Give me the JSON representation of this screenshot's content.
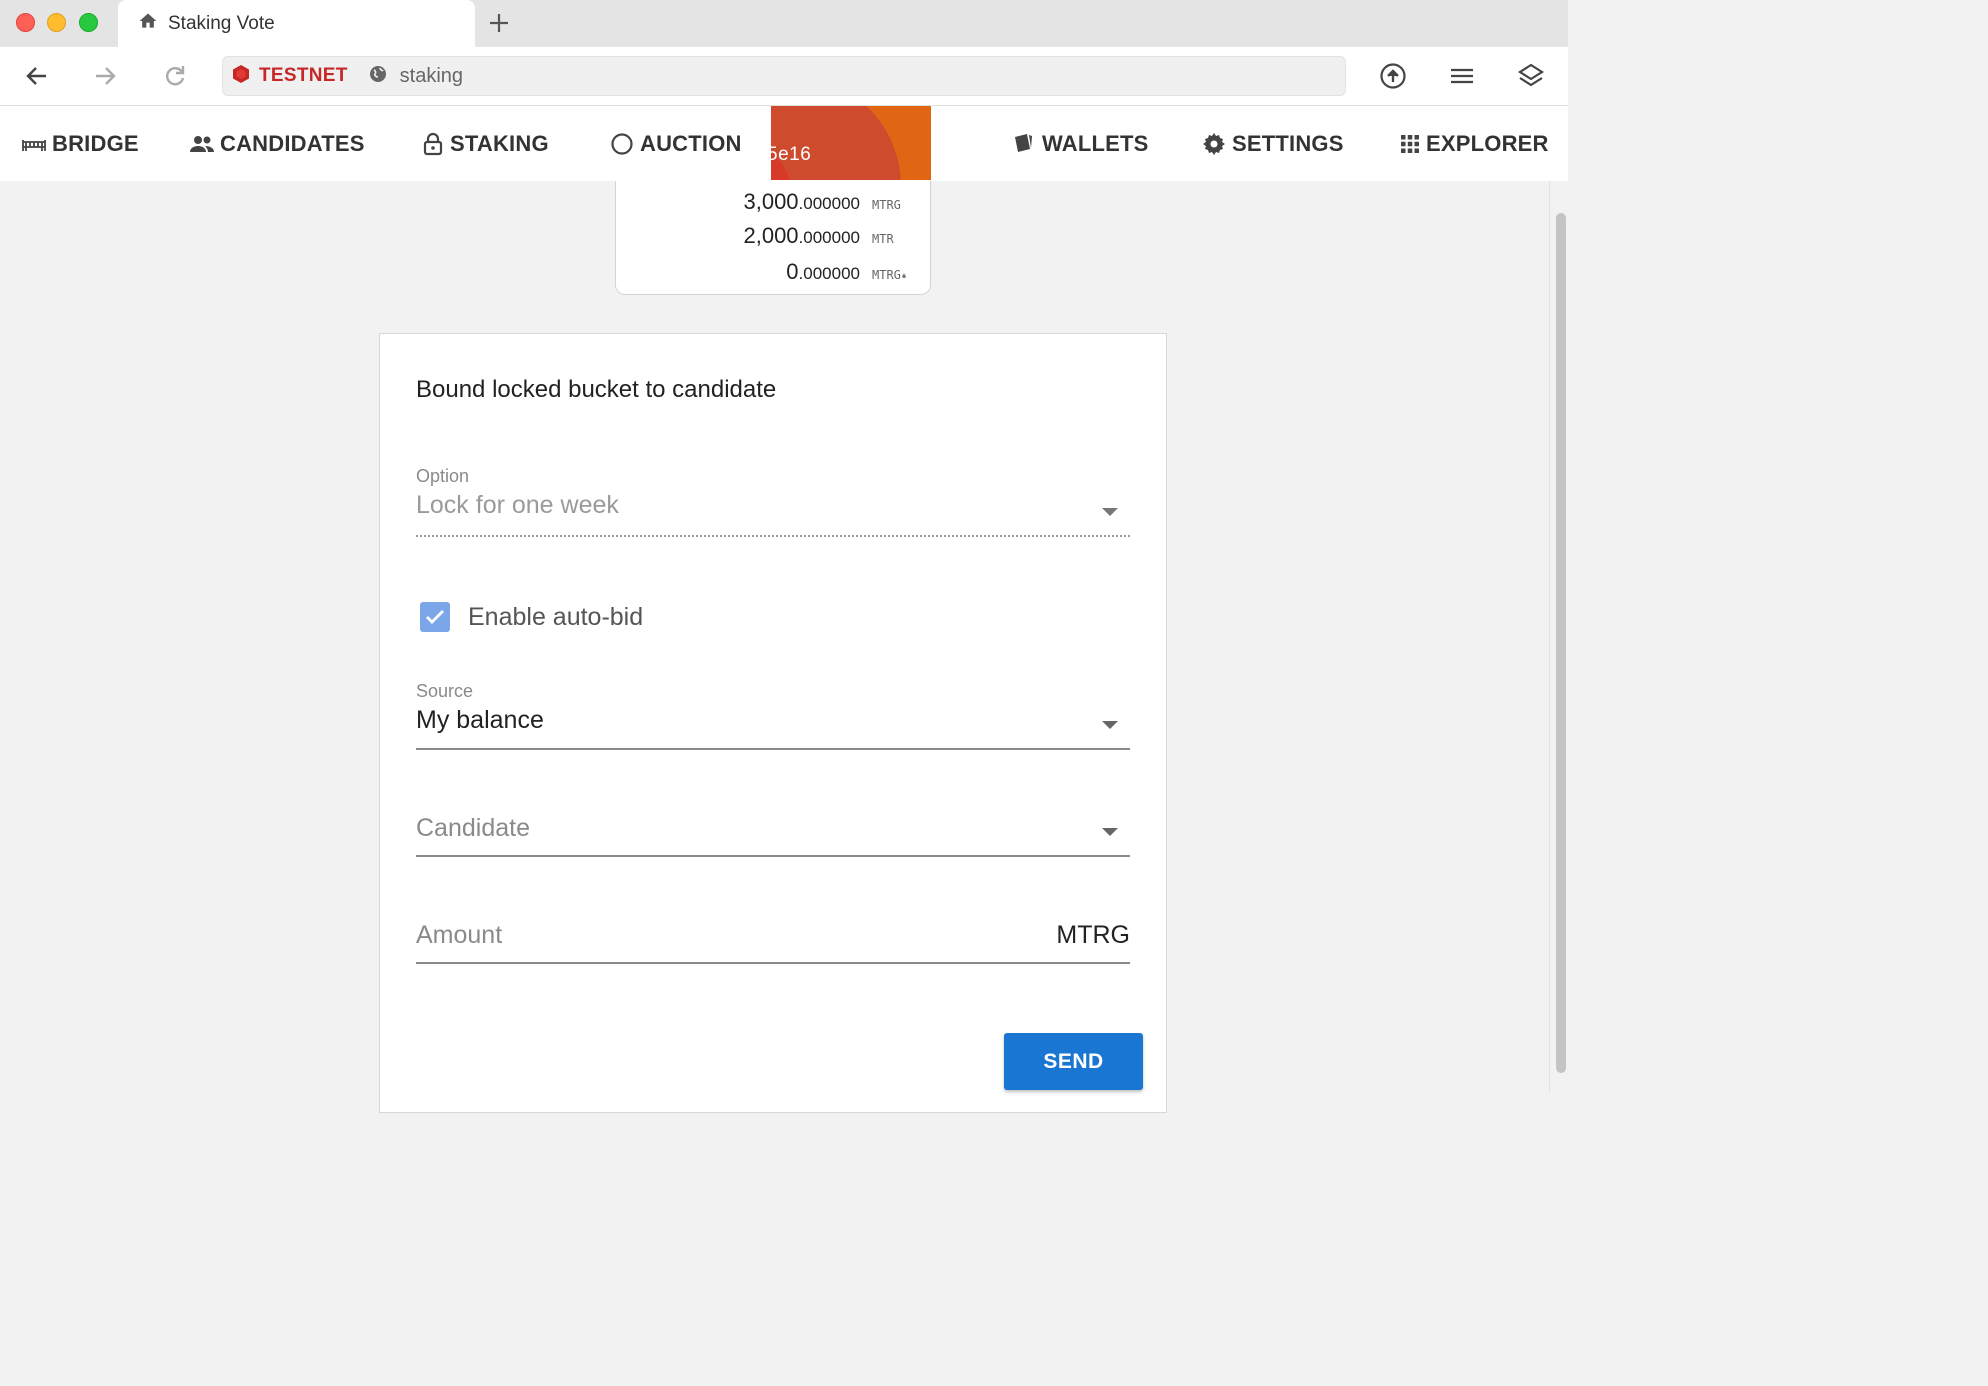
{
  "browser": {
    "tab_title": "Staking Vote",
    "network_label": "TESTNET",
    "url": "staking"
  },
  "nav": {
    "items": [
      {
        "label": "BRIDGE",
        "icon": "bridge-icon"
      },
      {
        "label": "CANDIDATES",
        "icon": "people-icon"
      },
      {
        "label": "STAKING",
        "icon": "lock-icon"
      },
      {
        "label": "AUCTION",
        "icon": "auction-icon"
      },
      {
        "label": "WALLETS",
        "icon": "wallet-icon"
      },
      {
        "label": "SETTINGS",
        "icon": "gear-icon"
      },
      {
        "label": "EXPLORER",
        "icon": "grid-icon"
      }
    ]
  },
  "wallet": {
    "address_fragment": "5e16",
    "card_color": "#e06614",
    "balances": [
      {
        "int": "3,000",
        "dec": ".000000",
        "unit": "MTRG"
      },
      {
        "int": "2,000",
        "dec": ".000000",
        "unit": "MTR"
      },
      {
        "int": "0",
        "dec": ".000000",
        "unit": "MTRG"
      }
    ]
  },
  "form": {
    "title": "Bound locked bucket to candidate",
    "option": {
      "label": "Option",
      "value": "Lock for one week"
    },
    "auto_bid": {
      "label": "Enable auto-bid",
      "checked": true
    },
    "source": {
      "label": "Source",
      "value": "My balance"
    },
    "candidate": {
      "placeholder": "Candidate"
    },
    "amount": {
      "placeholder": "Amount",
      "unit": "MTRG"
    },
    "send_label": "SEND"
  },
  "colors": {
    "accent": "#1976d2",
    "network": "#c62828",
    "checkbox": "#7ba7e8"
  }
}
